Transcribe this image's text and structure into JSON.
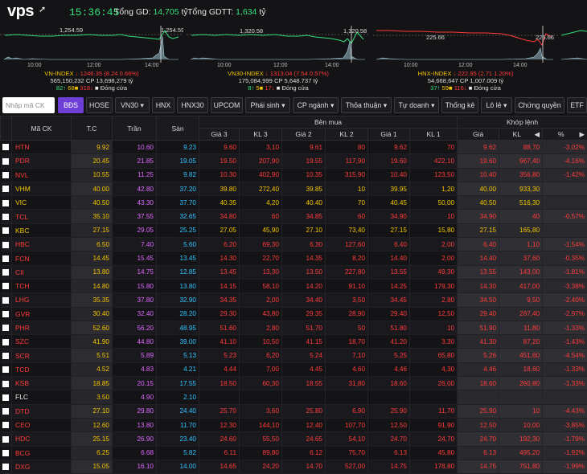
{
  "brand": {
    "logo": "vps",
    "clock": "15:36:45"
  },
  "summary": {
    "gd_label": "Tổng GD:",
    "gd_value": "14,705",
    "gd_unit": "tỷ",
    "gdtt_label": "Tổng GDTT:",
    "gdtt_value": "1,634",
    "gdtt_unit": "tỷ"
  },
  "indices": [
    {
      "name": "VN-INDEX",
      "value": "1246.35",
      "change": "(8.24",
      "pct": "0.66%)",
      "volume": "565,150,232",
      "cp": "CP",
      "value_traded": "13,698,279",
      "unit": "tỷ",
      "up": "82",
      "ref": "68",
      "down": "318",
      "status": "Đóng cửa",
      "peak_label": "1,254.59",
      "peak_label2": "1,254.59",
      "ticks": [
        "10:00",
        "12:00",
        "14:00"
      ]
    },
    {
      "name": "VN30-INDEX",
      "value": "1313.04",
      "change": "(7.54",
      "pct": "0.57%)",
      "volume": "175,084,999",
      "cp": "CP",
      "value_traded": "5,648.737",
      "unit": "tỷ",
      "up": "8",
      "ref": "5",
      "down": "17",
      "status": "Đóng cửa",
      "peak_label": "1,320.58",
      "peak_label2": "1,320.58",
      "ticks": [
        "10:00",
        "12:00",
        "14:00"
      ]
    },
    {
      "name": "HNX-INDEX",
      "value": "222.95",
      "change": "(2.71",
      "pct": "1.20%)",
      "volume": "54,668,647",
      "cp": "CP",
      "value_traded": "1,007.009",
      "unit": "tỷ",
      "up": "37",
      "ref": "59",
      "down": "116",
      "status": "Đóng cửa",
      "peak_label": "225.66",
      "peak_label2": "225.66",
      "ticks": [
        "10:00",
        "12:00",
        "14:00"
      ]
    }
  ],
  "toolbar": {
    "search_placeholder": "Nhập mã CK",
    "buttons": [
      "BĐS",
      "HOSE",
      "VN30",
      "HNX",
      "HNX30",
      "UPCOM",
      "Phái sinh",
      "CP ngành",
      "Thỏa thuận",
      "Tự doanh",
      "Thống kê",
      "Lô lẻ",
      "Chứng quyền",
      "ETF"
    ]
  },
  "table": {
    "headers": {
      "symbol": "Mã CK",
      "ref": "T.C",
      "ceil": "Trần",
      "floor": "Sàn",
      "buy": "Bên mua",
      "match": "Khớp lệnh",
      "g3": "Giá 3",
      "kl3": "KL 3",
      "g2": "Giá 2",
      "kl2": "KL 2",
      "g1": "Giá 1",
      "kl1": "KL 1",
      "price": "Giá",
      "kl": "KL",
      "pct": "%"
    },
    "rows": [
      {
        "s": "HTN",
        "tc": "9.92",
        "tr": "10.60",
        "sa": "9.23",
        "g3": "9.60",
        "k3": "3,10",
        "g2": "9.61",
        "k2": "80",
        "g1": "9.62",
        "k1": "70",
        "p": "9.62",
        "kl": "88,70",
        "pct": "-3.02%",
        "c": "dn"
      },
      {
        "s": "PDR",
        "tc": "20.45",
        "tr": "21.85",
        "sa": "19.05",
        "g3": "19.50",
        "k3": "207,90",
        "g2": "19.55",
        "k2": "117,90",
        "g1": "19.60",
        "k1": "422,10",
        "p": "19.60",
        "kl": "967,40",
        "pct": "-4.16%",
        "c": "dn"
      },
      {
        "s": "NVL",
        "tc": "10.55",
        "tr": "11.25",
        "sa": "9.82",
        "g3": "10.30",
        "k3": "402,90",
        "g2": "10.35",
        "k2": "315,90",
        "g1": "10.40",
        "k1": "123,50",
        "p": "10.40",
        "kl": "356,80",
        "pct": "-1.42%",
        "c": "dn"
      },
      {
        "s": "VHM",
        "tc": "40.00",
        "tr": "42.80",
        "sa": "37.20",
        "g3": "39.80",
        "k3": "272,40",
        "g2": "39.85",
        "k2": "10",
        "g1": "39.95",
        "k1": "1,20",
        "p": "40.00",
        "kl": "933,30",
        "pct": "",
        "c": "ref"
      },
      {
        "s": "VIC",
        "tc": "40.50",
        "tr": "43.30",
        "sa": "37.70",
        "g3": "40.35",
        "k3": "4,20",
        "g2": "40.40",
        "k2": "70",
        "g1": "40.45",
        "k1": "50,00",
        "p": "40.50",
        "kl": "516,30",
        "pct": "",
        "c": "ref"
      },
      {
        "s": "TCL",
        "tc": "35.10",
        "tr": "37.55",
        "sa": "32.65",
        "g3": "34.80",
        "k3": "60",
        "g2": "34.85",
        "k2": "60",
        "g1": "34.90",
        "k1": "10",
        "p": "34.90",
        "kl": "40",
        "pct": "-0.57%",
        "c": "dn"
      },
      {
        "s": "KBC",
        "tc": "27.15",
        "tr": "29.05",
        "sa": "25.25",
        "g3": "27.05",
        "k3": "45,90",
        "g2": "27.10",
        "k2": "73,40",
        "g1": "27.15",
        "k1": "15,80",
        "p": "27.15",
        "kl": "165,80",
        "pct": "",
        "c": "ref"
      },
      {
        "s": "HBC",
        "tc": "6.50",
        "tr": "7.40",
        "sa": "5.60",
        "g3": "6.20",
        "k3": "69,30",
        "g2": "6.30",
        "k2": "127,60",
        "g1": "6.40",
        "k1": "2,00",
        "p": "6.40",
        "kl": "1,10",
        "pct": "-1.54%",
        "c": "dn"
      },
      {
        "s": "FCN",
        "tc": "14.45",
        "tr": "15.45",
        "sa": "13.45",
        "g3": "14.30",
        "k3": "22,70",
        "g2": "14.35",
        "k2": "8,20",
        "g1": "14.40",
        "k1": "2,00",
        "p": "14.40",
        "kl": "37,60",
        "pct": "-0.35%",
        "c": "dn"
      },
      {
        "s": "CII",
        "tc": "13.80",
        "tr": "14.75",
        "sa": "12.85",
        "g3": "13.45",
        "k3": "13,30",
        "g2": "13.50",
        "k2": "227,80",
        "g1": "13.55",
        "k1": "49,30",
        "p": "13.55",
        "kl": "143,00",
        "pct": "-1.81%",
        "c": "dn"
      },
      {
        "s": "TCH",
        "tc": "14.80",
        "tr": "15.80",
        "sa": "13.80",
        "g3": "14.15",
        "k3": "58,10",
        "g2": "14.20",
        "k2": "91,10",
        "g1": "14.25",
        "k1": "179,30",
        "p": "14.30",
        "kl": "417,00",
        "pct": "-3.38%",
        "c": "dn"
      },
      {
        "s": "LHG",
        "tc": "35.35",
        "tr": "37.80",
        "sa": "32.90",
        "g3": "34.35",
        "k3": "2,00",
        "g2": "34.40",
        "k2": "3,50",
        "g1": "34.45",
        "k1": "2,80",
        "p": "34.50",
        "kl": "9,50",
        "pct": "-2.40%",
        "c": "dn"
      },
      {
        "s": "GVR",
        "tc": "30.40",
        "tr": "32.40",
        "sa": "28.20",
        "g3": "29.30",
        "k3": "43,80",
        "g2": "29.35",
        "k2": "28,90",
        "g1": "29.40",
        "k1": "12,50",
        "p": "29.40",
        "kl": "287,40",
        "pct": "-2.97%",
        "c": "dn"
      },
      {
        "s": "PHR",
        "tc": "52.60",
        "tr": "56.20",
        "sa": "48.95",
        "g3": "51.60",
        "k3": "2,80",
        "g2": "51.70",
        "k2": "50",
        "g1": "51.80",
        "k1": "10",
        "p": "51.90",
        "kl": "11,80",
        "pct": "-1.33%",
        "c": "dn"
      },
      {
        "s": "SZC",
        "tc": "41.90",
        "tr": "44.80",
        "sa": "39.00",
        "g3": "41.10",
        "k3": "10,50",
        "g2": "41.15",
        "k2": "18,70",
        "g1": "41.20",
        "k1": "3,30",
        "p": "41.30",
        "kl": "87,20",
        "pct": "-1.43%",
        "c": "dn"
      },
      {
        "s": "SCR",
        "tc": "5.51",
        "tr": "5.89",
        "sa": "5.13",
        "g3": "5.23",
        "k3": "6,20",
        "g2": "5.24",
        "k2": "7,10",
        "g1": "5.25",
        "k1": "65,80",
        "p": "5.26",
        "kl": "451,60",
        "pct": "-4.54%",
        "c": "dn"
      },
      {
        "s": "TCD",
        "tc": "4.52",
        "tr": "4.83",
        "sa": "4.21",
        "g3": "4.44",
        "k3": "7,00",
        "g2": "4.45",
        "k2": "4,60",
        "g1": "4.46",
        "k1": "4,30",
        "p": "4.46",
        "kl": "18,60",
        "pct": "-1.33%",
        "c": "dn"
      },
      {
        "s": "KSB",
        "tc": "18.85",
        "tr": "20.15",
        "sa": "17.55",
        "g3": "18.50",
        "k3": "60,30",
        "g2": "18.55",
        "k2": "31,80",
        "g1": "18.60",
        "k1": "26,00",
        "p": "18.60",
        "kl": "260,80",
        "pct": "-1.33%",
        "c": "dn"
      },
      {
        "s": "FLC",
        "tc": "3.50",
        "tr": "4.90",
        "sa": "2.10",
        "g3": "",
        "k3": "",
        "g2": "",
        "k2": "",
        "g1": "",
        "k1": "",
        "p": "",
        "kl": "",
        "pct": "",
        "c": "wt"
      },
      {
        "s": "DTD",
        "tc": "27.10",
        "tr": "29.80",
        "sa": "24.40",
        "g3": "25.70",
        "k3": "3,60",
        "g2": "25.80",
        "k2": "6,90",
        "g1": "25.90",
        "k1": "11,70",
        "p": "25.90",
        "kl": "10",
        "pct": "-4.43%",
        "c": "dn"
      },
      {
        "s": "CEO",
        "tc": "12.60",
        "tr": "13.80",
        "sa": "11.70",
        "g3": "12.30",
        "k3": "144,10",
        "g2": "12.40",
        "k2": "107,70",
        "g1": "12.50",
        "k1": "91,90",
        "p": "12.50",
        "kl": "10,00",
        "pct": "-3.85%",
        "c": "dn"
      },
      {
        "s": "HDC",
        "tc": "25.15",
        "tr": "26.90",
        "sa": "23.40",
        "g3": "24.60",
        "k3": "55,50",
        "g2": "24.65",
        "k2": "54,10",
        "g1": "24.70",
        "k1": "24,70",
        "p": "24.70",
        "kl": "192,30",
        "pct": "-1.79%",
        "c": "dn"
      },
      {
        "s": "BCG",
        "tc": "6.25",
        "tr": "6.68",
        "sa": "5.82",
        "g3": "6.11",
        "k3": "89,80",
        "g2": "6.12",
        "k2": "75,70",
        "g1": "6.13",
        "k1": "45,80",
        "p": "6.13",
        "kl": "495,20",
        "pct": "-1.92%",
        "c": "dn"
      },
      {
        "s": "DXG",
        "tc": "15.05",
        "tr": "16.10",
        "sa": "14.00",
        "g3": "14.65",
        "k3": "24,20",
        "g2": "14.70",
        "k2": "527,00",
        "g1": "14.75",
        "k1": "178,80",
        "p": "14.75",
        "kl": "751,80",
        "pct": "-1.99%",
        "c": "dn"
      }
    ]
  },
  "colors": {
    "up": "#35e07d",
    "down": "#ff3b3b",
    "ref": "#f3c400",
    "ceiling": "#e066ff",
    "floor": "#31c3ff",
    "active": "#6e3fd6"
  },
  "chart_data": [
    {
      "type": "line",
      "title": "VN-INDEX",
      "x_ticks": [
        "10:00",
        "12:00",
        "14:00"
      ],
      "reference": 1254.59,
      "close": 1246.35
    },
    {
      "type": "line",
      "title": "VN30-INDEX",
      "x_ticks": [
        "10:00",
        "12:00",
        "14:00"
      ],
      "reference": 1320.58,
      "close": 1313.04
    },
    {
      "type": "line",
      "title": "HNX-INDEX",
      "x_ticks": [
        "10:00",
        "12:00",
        "14:00"
      ],
      "reference": 225.66,
      "close": 222.95
    }
  ]
}
